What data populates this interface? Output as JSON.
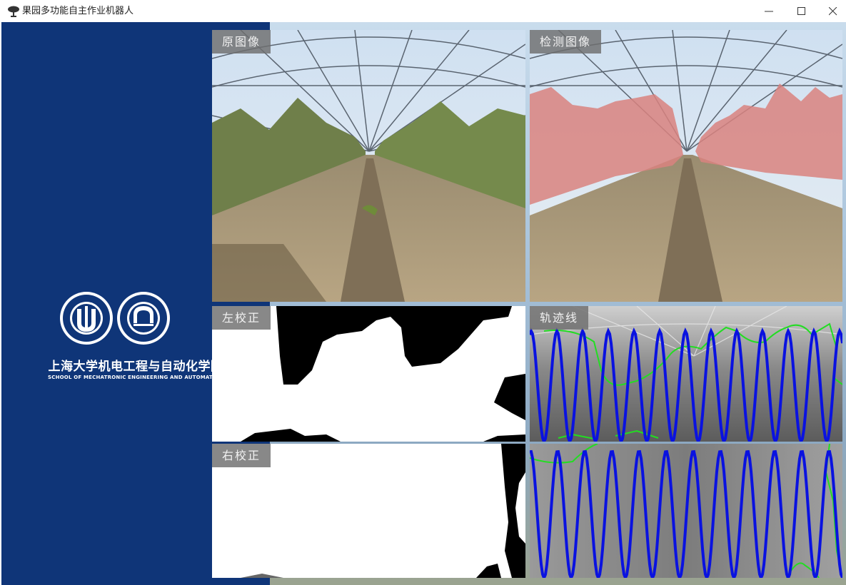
{
  "window": {
    "title": "果园多功能自主作业机器人",
    "app_icon": "tree-icon",
    "controls": {
      "minimize": "minimize-icon",
      "maximize": "maximize-icon",
      "close": "close-icon"
    }
  },
  "sidebar": {
    "logo_left": "shanghai-university-seal-icon",
    "logo_right": "mechatronic-school-seal-icon",
    "school_name_cn": "上海大学机电工程与自动化学院",
    "school_name_en": "SCHOOL OF MECHATRONIC ENGINEERING AND AUTOMATION"
  },
  "panels": {
    "original": {
      "label": "原图像"
    },
    "detection": {
      "label": "检测图像"
    },
    "left_correction": {
      "label": "左校正"
    },
    "right_correction": {
      "label": "右校正"
    },
    "trajectory": {
      "label": "轨迹线"
    }
  },
  "colors": {
    "sidebar_bg": "#0f3578",
    "label_bg": "#6e6e6e",
    "detection_overlay": "#d9837f",
    "trajectory_line": "#0a12e0",
    "contour_line": "#22dd22"
  }
}
